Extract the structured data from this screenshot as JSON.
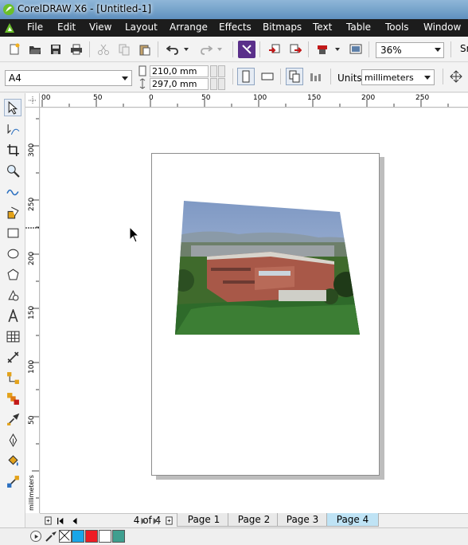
{
  "window": {
    "title": "CorelDRAW X6 - [Untitled-1]"
  },
  "menu": [
    "File",
    "Edit",
    "View",
    "Layout",
    "Arrange",
    "Effects",
    "Bitmaps",
    "Text",
    "Table",
    "Tools",
    "Window"
  ],
  "toolbar": {
    "zoom_value": "36%",
    "snap_label": "Sn"
  },
  "property_bar": {
    "page_size": "A4",
    "width": "210,0 mm",
    "height": "297,0 mm",
    "units_label": "Units:",
    "units_value": "millimeters"
  },
  "ruler_h": {
    "labels": [
      "00",
      "50",
      "0",
      "50",
      "100",
      "150",
      "200",
      "250"
    ]
  },
  "ruler_v": {
    "labels": [
      "300",
      "250",
      "200",
      "150",
      "100",
      "50",
      "millimeters"
    ]
  },
  "page_nav": {
    "count": "4 of 4",
    "tabs": [
      "Page 1",
      "Page 2",
      "Page 3",
      "Page 4"
    ],
    "active_tab": "Page 4"
  },
  "palette": {
    "colors": [
      "#19a6e8",
      "#ee1c24",
      "#ffffff",
      "#3f9f8f"
    ]
  }
}
